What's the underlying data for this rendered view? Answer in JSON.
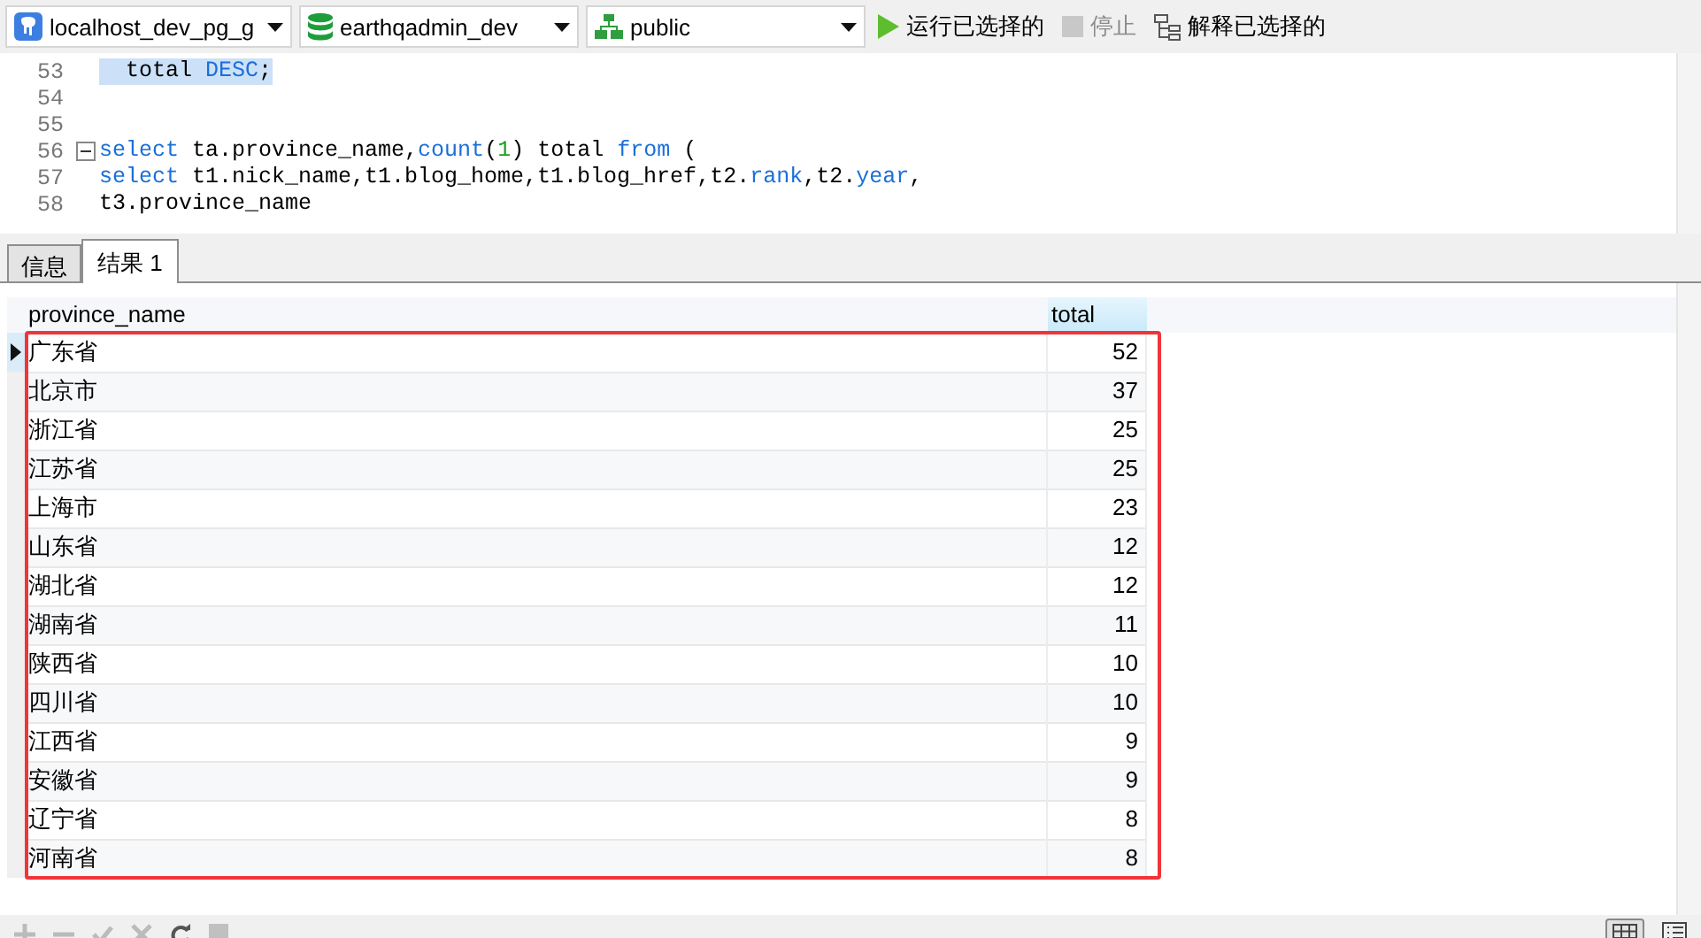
{
  "toolbar": {
    "connection": "localhost_dev_pg_g",
    "database": "earthqadmin_dev",
    "schema": "public",
    "buttons": [
      {
        "kind": "run",
        "label": "运行已选择的",
        "disabled": false
      },
      {
        "kind": "stop",
        "label": "停止",
        "disabled": true
      },
      {
        "kind": "explain",
        "label": "解释已选择的",
        "disabled": false
      }
    ]
  },
  "editor": {
    "lines": [
      {
        "number": "53",
        "selected": true,
        "fold": false,
        "segments": [
          {
            "text": "  total ",
            "kind": "plain"
          },
          {
            "text": "DESC",
            "kind": "keyword"
          },
          {
            "text": ";",
            "kind": "plain"
          }
        ]
      },
      {
        "number": "54",
        "selected": false,
        "fold": false
      },
      {
        "number": "55",
        "selected": false,
        "fold": false
      },
      {
        "number": "56",
        "selected": false,
        "fold": true,
        "segments": [
          {
            "text": "select",
            "kind": "keyword"
          },
          {
            "text": " ta.province_name,",
            "kind": "plain"
          },
          {
            "text": "count",
            "kind": "keyword"
          },
          {
            "text": "(",
            "kind": "plain"
          },
          {
            "text": "1",
            "kind": "number"
          },
          {
            "text": ") total ",
            "kind": "plain"
          },
          {
            "text": "from",
            "kind": "keyword"
          },
          {
            "text": " (",
            "kind": "plain"
          }
        ]
      },
      {
        "number": "57",
        "selected": false,
        "fold": false,
        "segments": [
          {
            "text": "select",
            "kind": "keyword"
          },
          {
            "text": " t1.nick_name,t1.blog_home,t1.blog_href,t2.",
            "kind": "plain"
          },
          {
            "text": "rank",
            "kind": "keyword"
          },
          {
            "text": ",t2.",
            "kind": "plain"
          },
          {
            "text": "year",
            "kind": "keyword"
          },
          {
            "text": ",",
            "kind": "plain"
          }
        ]
      },
      {
        "number": "58",
        "selected": false,
        "fold": false,
        "segments": [
          {
            "text": "t3.province_name",
            "kind": "plain"
          }
        ]
      }
    ]
  },
  "result_tabs": [
    {
      "label": "信息",
      "selected": false
    },
    {
      "label": "结果 1",
      "selected": true
    }
  ],
  "table": {
    "columns": [
      "province_name",
      "total"
    ],
    "rows": [
      {
        "cells": [
          "广东省",
          "52"
        ],
        "selected": true
      },
      {
        "cells": [
          "北京市",
          "37"
        ],
        "selected": false
      },
      {
        "cells": [
          "浙江省",
          "25"
        ],
        "selected": false
      },
      {
        "cells": [
          "江苏省",
          "25"
        ],
        "selected": false
      },
      {
        "cells": [
          "上海市",
          "23"
        ],
        "selected": false
      },
      {
        "cells": [
          "山东省",
          "12"
        ],
        "selected": false
      },
      {
        "cells": [
          "湖北省",
          "12"
        ],
        "selected": false
      },
      {
        "cells": [
          "湖南省",
          "11"
        ],
        "selected": false
      },
      {
        "cells": [
          "陕西省",
          "10"
        ],
        "selected": false
      },
      {
        "cells": [
          "四川省",
          "10"
        ],
        "selected": false
      },
      {
        "cells": [
          "江西省",
          "9"
        ],
        "selected": false
      },
      {
        "cells": [
          "安徽省",
          "9"
        ],
        "selected": false
      },
      {
        "cells": [
          "辽宁省",
          "8"
        ],
        "selected": false
      },
      {
        "cells": [
          "河南省",
          "8"
        ],
        "selected": false
      }
    ]
  }
}
